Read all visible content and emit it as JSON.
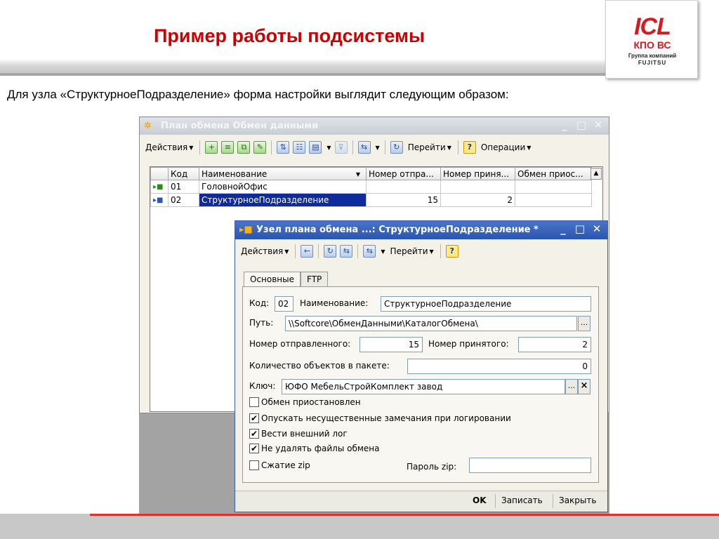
{
  "slide": {
    "title": "Пример работы подсистемы",
    "intro": "Для узла «СтруктурноеПодразделение» форма настройки выглядит следующим образом:",
    "logo": {
      "brand": "ICL",
      "line2": "КПО ВС",
      "line3": "Группа компаний",
      "line4": "FUJITSU"
    }
  },
  "exchange_plan": {
    "title": "План обмена Обмен данными",
    "toolbar": {
      "actions": "Действия",
      "goto": "Перейти",
      "operations": "Операции"
    },
    "columns": [
      "Код",
      "Наименование",
      "Номер отпра...",
      "Номер приня...",
      "Обмен приос..."
    ],
    "rows": [
      {
        "code": "01",
        "name": "ГоловнойОфис",
        "sent": "",
        "received": "",
        "paused": ""
      },
      {
        "code": "02",
        "name": "СтруктурноеПодразделение",
        "sent": "15",
        "received": "2",
        "paused": ""
      }
    ]
  },
  "node": {
    "title": "Узел плана обмена ...: СтруктурноеПодразделение *",
    "toolbar": {
      "actions": "Действия",
      "goto": "Перейти"
    },
    "tabs": [
      "Основные",
      "FTP"
    ],
    "code_label": "Код:",
    "code": "02",
    "name_label": "Наименование:",
    "name": "СтруктурноеПодразделение",
    "path_label": "Путь:",
    "path": "\\\\Softcore\\ОбменДанными\\КаталогОбмена\\",
    "sent_label": "Номер отправленного:",
    "sent": "15",
    "received_label": "Номер принятого:",
    "received": "2",
    "count_label": "Количество объектов в пакете:",
    "count": "0",
    "key_label": "Ключ:",
    "key": "ЮФО МебельСтройКомплект завод",
    "checkboxes": [
      {
        "label": "Обмен приостановлен",
        "checked": false
      },
      {
        "label": "Опускать несущественные замечания при логировании",
        "checked": true
      },
      {
        "label": "Вести внешний лог",
        "checked": true
      },
      {
        "label": "Не удалять файлы обмена",
        "checked": true
      },
      {
        "label": "Сжатие zip",
        "checked": false
      }
    ],
    "zip_password_label": "Пароль zip:",
    "zip_password": "",
    "buttons": {
      "ok": "OK",
      "save": "Записать",
      "close": "Закрыть"
    },
    "ellipsis": "...",
    "clear": "×"
  }
}
